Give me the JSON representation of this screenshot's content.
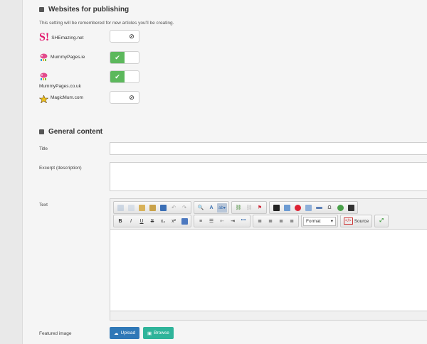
{
  "sections": {
    "publishing": {
      "title": "Websites for publishing",
      "note": "This setting will be remembered for new articles you'll be creating.",
      "sites": [
        {
          "name": "SHEmazing.net",
          "enabled": false,
          "logo": "shemazing-logo",
          "logo_text": "S!"
        },
        {
          "name": "MummyPages.ie",
          "enabled": true,
          "logo": "mummypages-ie-logo"
        },
        {
          "name": "MummyPages.co.uk",
          "enabled": true,
          "logo": "mummypages-couk-logo"
        },
        {
          "name": "MagicMum.com",
          "enabled": false,
          "logo": "magicmum-logo"
        }
      ]
    },
    "general": {
      "title": "General content",
      "fields": {
        "title_label": "Title",
        "title_value": "",
        "excerpt_label": "Excerpt (description)",
        "excerpt_value": "",
        "text_label": "Text",
        "featured_label": "Featured image"
      }
    }
  },
  "toolbar": {
    "format_label": "Format",
    "source_label": "Source",
    "bold": "B",
    "italic": "I",
    "underline": "U",
    "strike": "S",
    "subscript": "x₂",
    "superscript": "x²",
    "blockquote": "””",
    "omega": "Ω"
  },
  "buttons": {
    "upload_label": "Upload",
    "browse_label": "Browse"
  },
  "colors": {
    "toggle_on": "#5cb85c",
    "upload_button": "#2f78b7",
    "browse_button": "#2fb49a",
    "shemazing_brand": "#e2156b"
  }
}
